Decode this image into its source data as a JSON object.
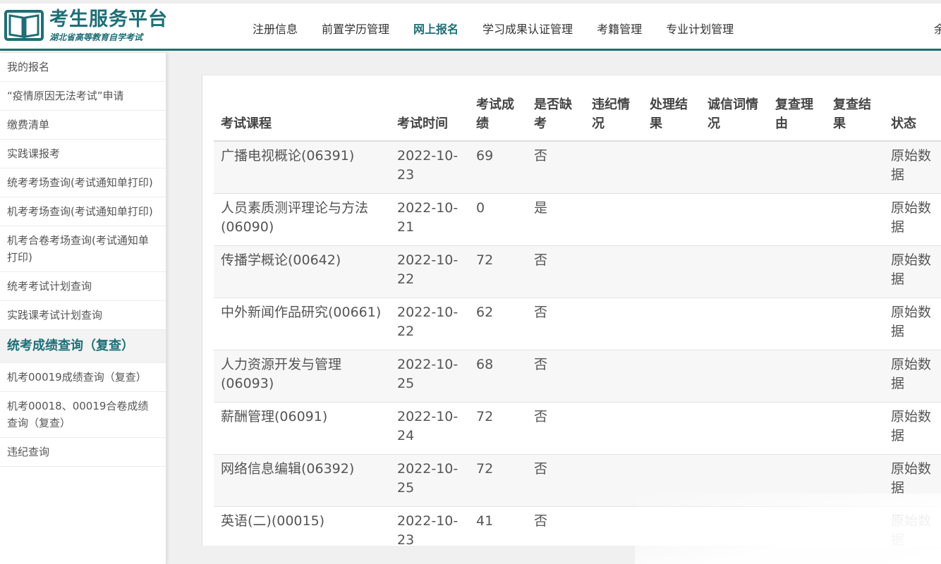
{
  "header": {
    "logo_title": "考生服务平台",
    "logo_subtitle": "湖北省高等教育自学考试",
    "nav": [
      "注册信息",
      "前置学历管理",
      "网上报名",
      "学习成果认证管理",
      "考籍管理",
      "专业计划管理"
    ],
    "nav_active": "网上报名",
    "nav_edge_text": "余"
  },
  "sidebar": {
    "items": [
      "我的报名",
      "“疫情原因无法考试”申请",
      "缴费清单",
      "实践课报考",
      "统考考场查询(考试通知单打印)",
      "机考考场查询(考试通知单打印)",
      "机考合卷考场查询(考试通知单打印)",
      "统考考试计划查询",
      "实践课考试计划查询",
      "统考成绩查询（复查）",
      "机考00019成绩查询（复查）",
      "机考00018、00019合卷成绩查询（复查）",
      "违纪查询"
    ],
    "active_index": 9
  },
  "table": {
    "headers": [
      "考试课程",
      "考试时间",
      "考试成绩",
      "是否缺考",
      "违纪情况",
      "处理结果",
      "诚信词情况",
      "复查理由",
      "复查结果",
      "状态"
    ],
    "rows": [
      [
        "广播电视概论(06391)",
        "2022-10-23",
        "69",
        "否",
        "",
        "",
        "",
        "",
        "",
        "原始数据"
      ],
      [
        "人员素质测评理论与方法(06090)",
        "2022-10-21",
        "0",
        "是",
        "",
        "",
        "",
        "",
        "",
        "原始数据"
      ],
      [
        "传播学概论(00642)",
        "2022-10-22",
        "72",
        "否",
        "",
        "",
        "",
        "",
        "",
        "原始数据"
      ],
      [
        "中外新闻作品研究(00661)",
        "2022-10-22",
        "62",
        "否",
        "",
        "",
        "",
        "",
        "",
        "原始数据"
      ],
      [
        "人力资源开发与管理(06093)",
        "2022-10-25",
        "68",
        "否",
        "",
        "",
        "",
        "",
        "",
        "原始数据"
      ],
      [
        "薪酬管理(06091)",
        "2022-10-24",
        "72",
        "否",
        "",
        "",
        "",
        "",
        "",
        "原始数据"
      ],
      [
        "网络信息编辑(06392)",
        "2022-10-25",
        "72",
        "否",
        "",
        "",
        "",
        "",
        "",
        "原始数据"
      ],
      [
        "英语(二)(00015)",
        "2022-10-23",
        "41",
        "否",
        "",
        "",
        "",
        "",
        "",
        "原始数据"
      ]
    ]
  },
  "colors": {
    "brand": "#1e6f77",
    "header_rule": "#1f6f6b"
  },
  "icons": {
    "logo": "open-book-icon"
  }
}
